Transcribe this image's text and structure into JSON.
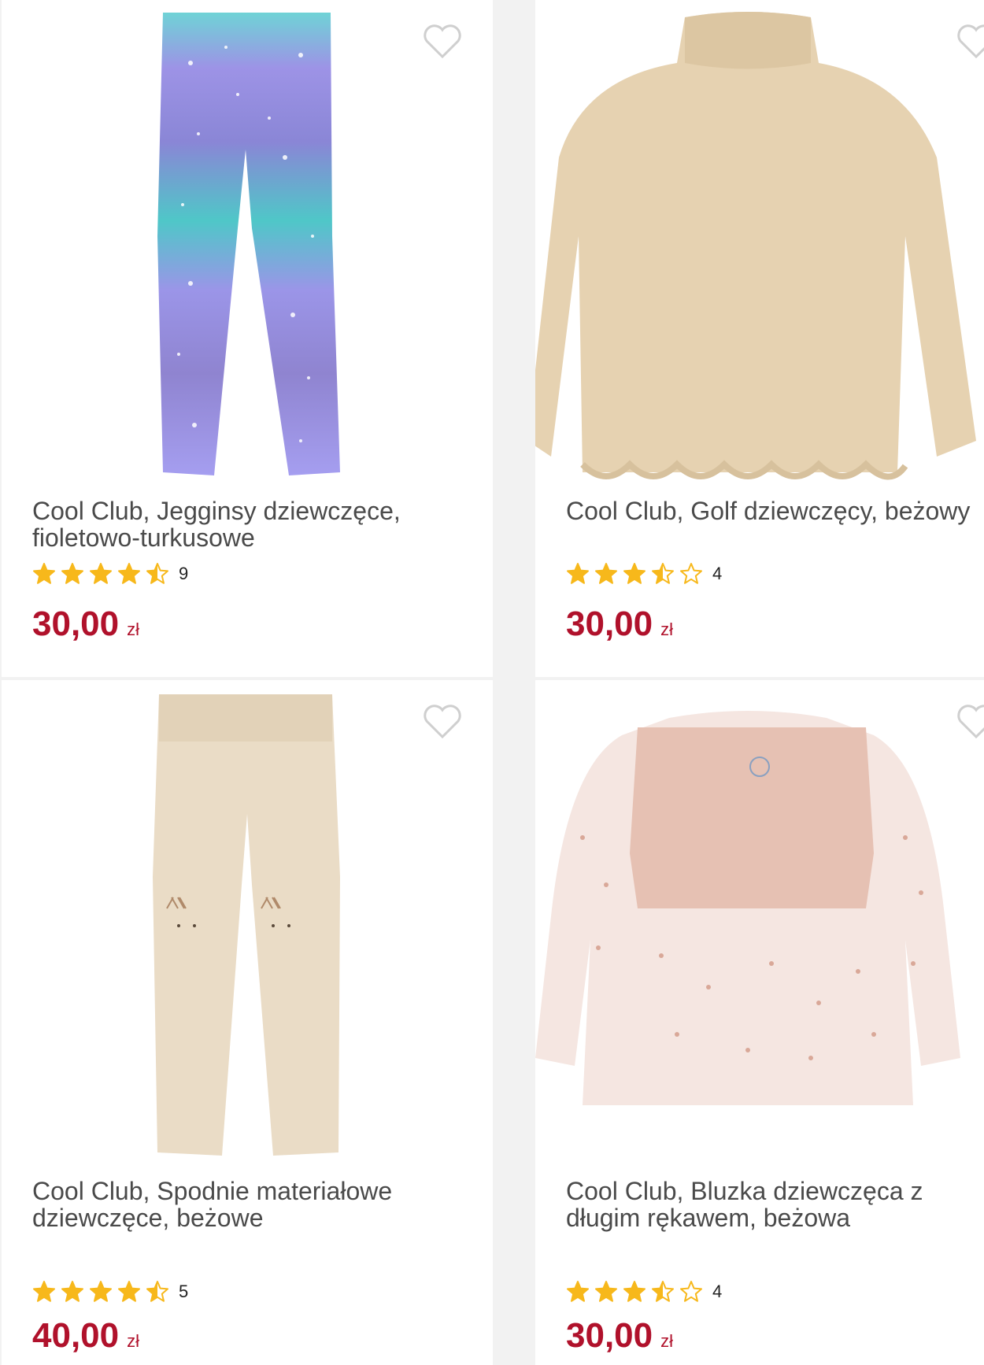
{
  "products": [
    {
      "title": "Cool Club, Jegginsy dziewczęce,\nfioletowo-turkusowe",
      "rating": 4.5,
      "review_count": "9",
      "price_amount": "30,00",
      "currency": "zł",
      "favorite_icon": "heart-outline-icon"
    },
    {
      "title": "Cool Club, Golf dziewczęcy, beżowy",
      "rating": 3.5,
      "review_count": "4",
      "price_amount": "30,00",
      "currency": "zł",
      "favorite_icon": "heart-outline-icon"
    },
    {
      "title": "Cool Club, Spodnie materiałowe\ndziewczęce, beżowe",
      "rating": 4.5,
      "review_count": "5",
      "price_amount": "40,00",
      "currency": "zł",
      "favorite_icon": "heart-outline-icon"
    },
    {
      "title": "Cool Club, Bluzka dziewczęca z\ndługim rękawem, beżowa",
      "rating": 3.5,
      "review_count": "4",
      "price_amount": "30,00",
      "currency": "zł",
      "favorite_icon": "heart-outline-icon"
    }
  ],
  "colors": {
    "price": "#b0112b",
    "star": "#f7b81b",
    "title": "#4a4a4a",
    "background": "#f2f2f2"
  }
}
